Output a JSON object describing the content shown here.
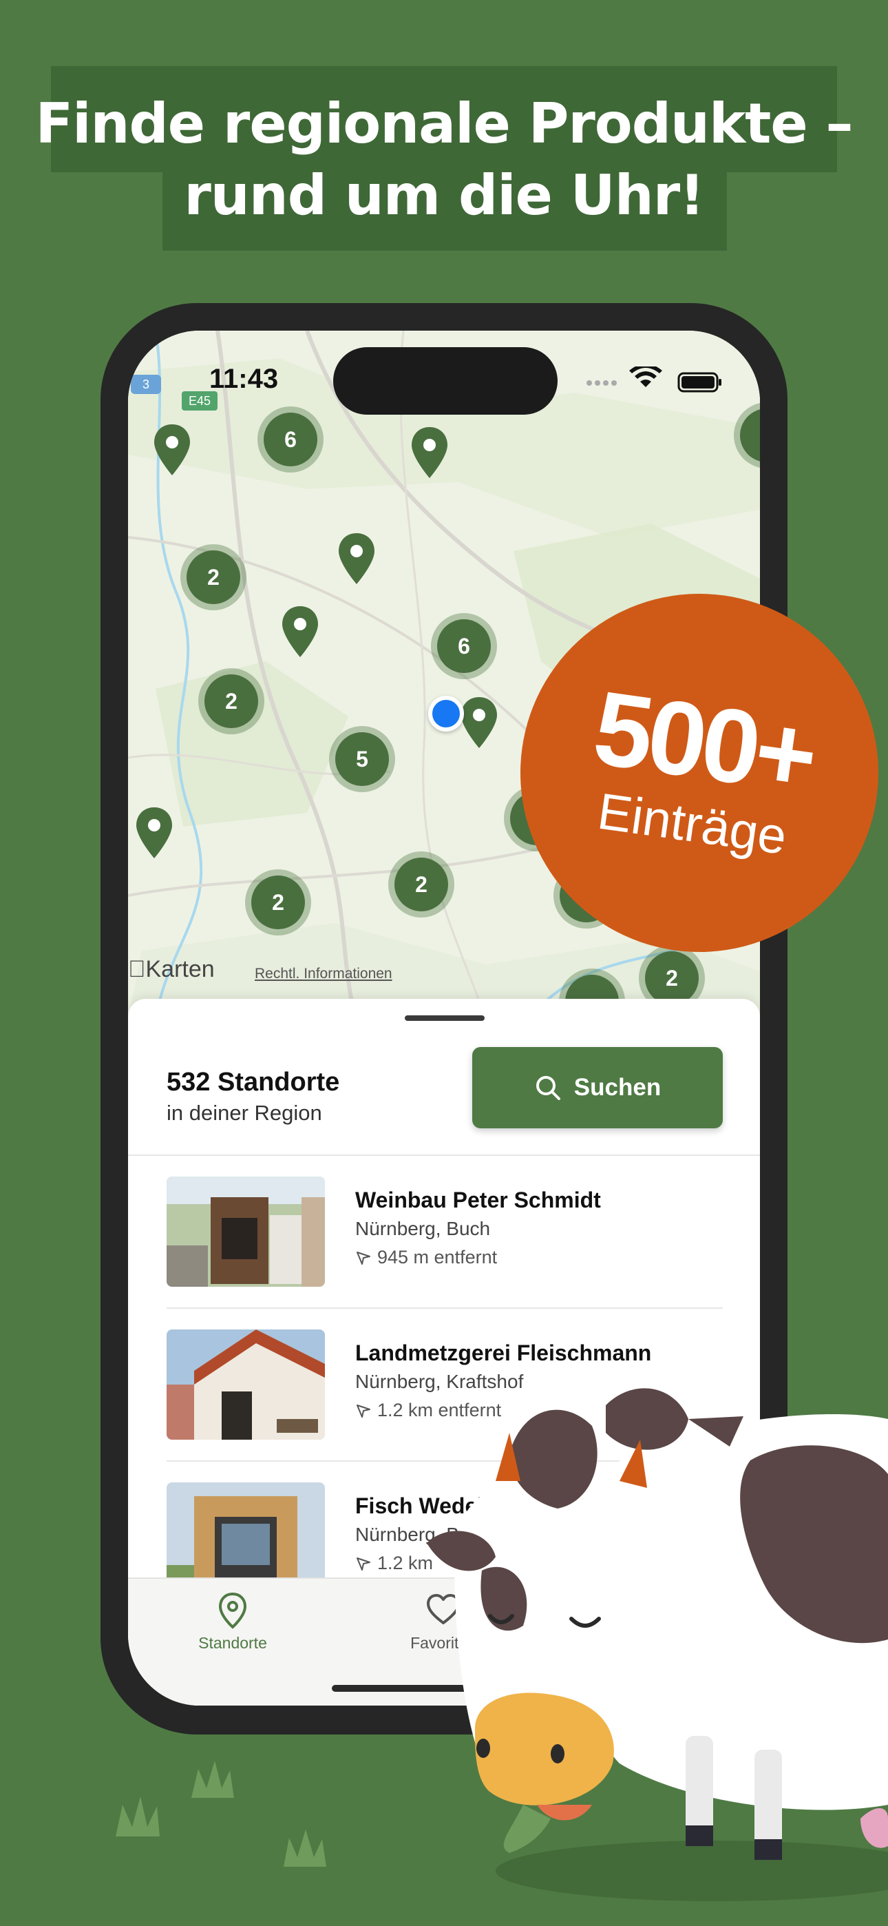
{
  "headline": {
    "line1": "Finde regionale Produkte –",
    "line2": "rund um die Uhr!"
  },
  "status": {
    "time": "11:43"
  },
  "map": {
    "clusters": [
      "6",
      "2",
      "6",
      "2",
      "5",
      "2",
      "2",
      "2"
    ],
    "road_labels": [
      "3",
      "E45"
    ],
    "attribution": "Karten",
    "legal": "Rechtl. Informationen"
  },
  "sheet": {
    "count": "532 Standorte",
    "region": "in deiner Region",
    "search_label": "Suchen"
  },
  "locations": [
    {
      "name": "Weinbau Peter Schmidt",
      "place": "Nürnberg, Buch",
      "distance": "945 m entfernt"
    },
    {
      "name": "Landmetzgerei Fleischmann",
      "place": "Nürnberg, Kraftshof",
      "distance": "1.2 km entfernt"
    },
    {
      "name": "Fisch Wedel",
      "place": "Nürnberg, Boxdorf",
      "distance": "1.2 km"
    }
  ],
  "tabs": [
    {
      "label": "Standorte",
      "active": true
    },
    {
      "label": "Favoriten",
      "active": false
    }
  ],
  "badge": {
    "number": "500+",
    "text": "Einträge"
  },
  "colors": {
    "brand_green": "#4f7a44",
    "dark_green": "#3f6837",
    "badge_orange": "#cf5a17"
  }
}
